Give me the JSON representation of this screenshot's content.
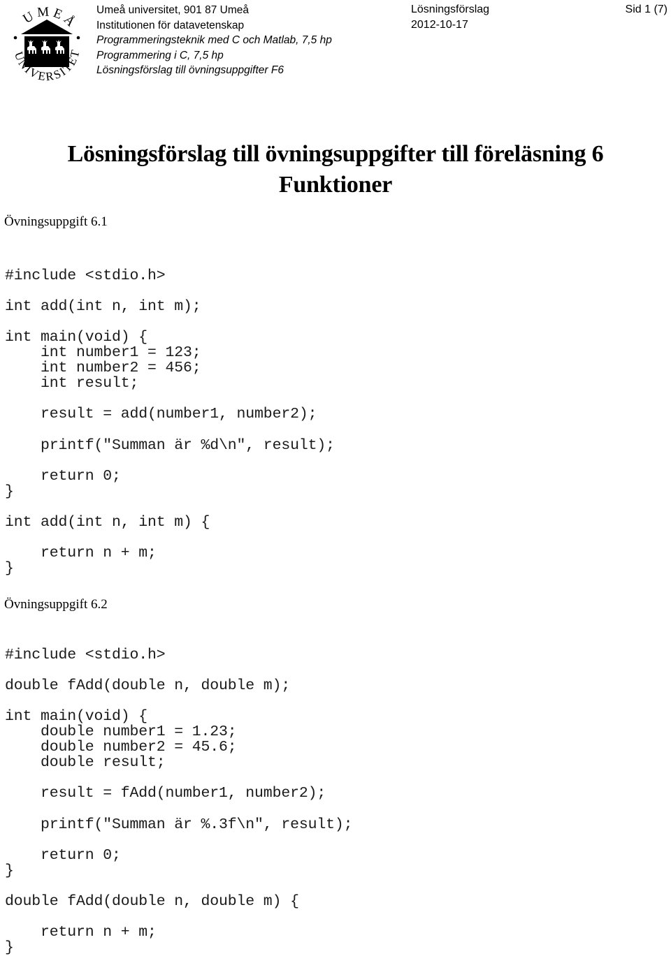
{
  "header": {
    "logo": {
      "icon": "umea-university-seal",
      "ring_text_top": "UMEÅ",
      "ring_text_bottom": "UNIVERSITET"
    },
    "org_lines": [
      {
        "text": "Umeå universitet, 901 87 Umeå",
        "italic": false
      },
      {
        "text": "Institutionen för datavetenskap",
        "italic": false
      },
      {
        "text": "Programmeringsteknik med C och Matlab, 7,5 hp",
        "italic": true
      },
      {
        "text": "Programmering i C, 7,5 hp",
        "italic": true
      },
      {
        "text": "Lösningsförslag till övningsuppgifter F6",
        "italic": true
      }
    ],
    "doc_type": "Lösningsförslag",
    "date": "2012-10-17",
    "page_label": "Sid 1 (7)"
  },
  "title": {
    "line1": "Lösningsförslag till övningsuppgifter till föreläsning 6",
    "line2": "Funktioner"
  },
  "sections": [
    {
      "heading": "Övningsuppgift 6.1",
      "code": [
        "#include <stdio.h>",
        "",
        "int add(int n, int m);",
        "",
        "int main(void) {",
        "    int number1 = 123;",
        "    int number2 = 456;",
        "    int result;",
        "",
        "    result = add(number1, number2);",
        "",
        "    printf(\"Summan är %d\\n\", result);",
        "",
        "    return 0;",
        "}",
        "",
        "int add(int n, int m) {",
        "",
        "    return n + m;",
        "}"
      ]
    },
    {
      "heading": "Övningsuppgift 6.2",
      "code": [
        "#include <stdio.h>",
        "",
        "double fAdd(double n, double m);",
        "",
        "int main(void) {",
        "    double number1 = 1.23;",
        "    double number2 = 45.6;",
        "    double result;",
        "",
        "    result = fAdd(number1, number2);",
        "",
        "    printf(\"Summan är %.3f\\n\", result);",
        "",
        "    return 0;",
        "}",
        "",
        "double fAdd(double n, double m) {",
        "",
        "    return n + m;",
        "}"
      ]
    }
  ],
  "colors": {
    "text": "#000000",
    "code_text": "#1a1a1a",
    "background": "#ffffff"
  }
}
